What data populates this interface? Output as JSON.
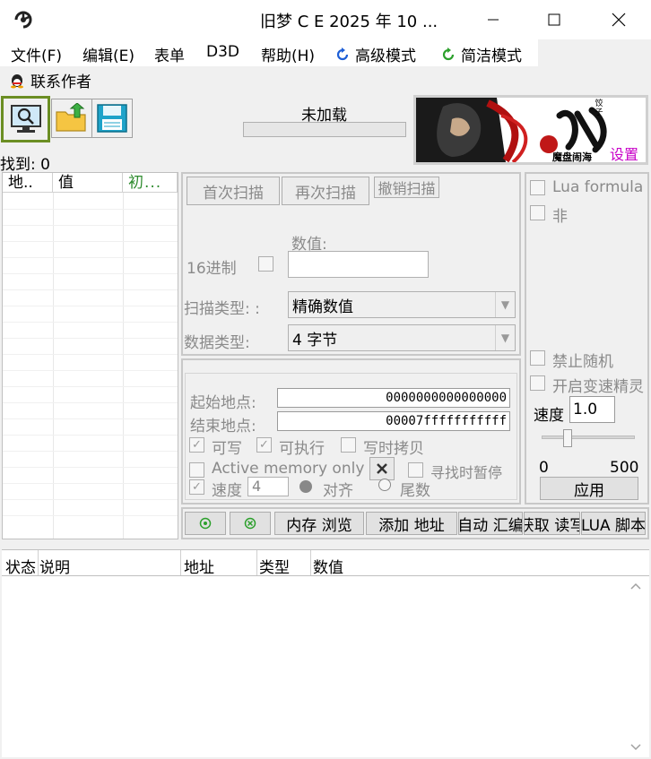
{
  "window": {
    "title": "旧梦 C E     2025 年  10 ..."
  },
  "menu": {
    "file": "文件(F)",
    "edit": "编辑(E)",
    "table": "表单",
    "d3d": "D3D",
    "help": "帮助(H)",
    "advanced": "高级模式",
    "simple": "简洁模式",
    "contact": "联系作者"
  },
  "status": {
    "loaded": "未加载",
    "found": "找到: 0"
  },
  "banner": {
    "settings": "设置",
    "brand_line1": "饺子",
    "brand_line2": "魔盘闹海"
  },
  "addr_list": {
    "col_address": "地..",
    "col_value": "值",
    "col_initial": "初..."
  },
  "scan": {
    "first_scan": "首次扫描",
    "next_scan": "再次扫描",
    "undo_scan": "撤销扫描",
    "value_label": "数值:",
    "hex_label": "16进制",
    "scan_type_label": "扫描类型: :",
    "scan_type_value": "精确数值",
    "data_type_label": "数据类型:",
    "data_type_value": "4 字节"
  },
  "memory": {
    "start_label": "起始地点:",
    "start_value": "0000000000000000",
    "end_label": "结束地点:",
    "end_value": "00007fffffffffff",
    "writable": "可写",
    "executable": "可执行",
    "copy_on_write": "写时拷贝",
    "active_memory_only": "Active memory only",
    "pause_on_scan": "寻找时暂停",
    "speed_label": "速度",
    "speed_value": "4",
    "align": "对齐",
    "last_digits": "尾数"
  },
  "right_panel": {
    "lua_formula": "Lua formula",
    "not": "非",
    "disable_random": "禁止随机",
    "speedhack": "开启变速精灵",
    "speed_label": "速度",
    "speed_value": "1.0",
    "slider_min": "0",
    "slider_max": "500",
    "apply": "应用"
  },
  "bottom_toolbar": {
    "memory_view": "内存 浏览",
    "add_address": "添加 地址",
    "auto_assemble": "自动 汇编",
    "fetch_read": "获取 读写",
    "lua_script": "LUA  脚本"
  },
  "bottom_list": {
    "col_status": "状态",
    "col_desc": "说明",
    "col_address": "地址",
    "col_type": "类型",
    "col_value": "数值"
  },
  "colors": {
    "accent_green": "#6b8e23",
    "settings_magenta": "#c800c8",
    "initial_green": "#2e8b2e"
  }
}
